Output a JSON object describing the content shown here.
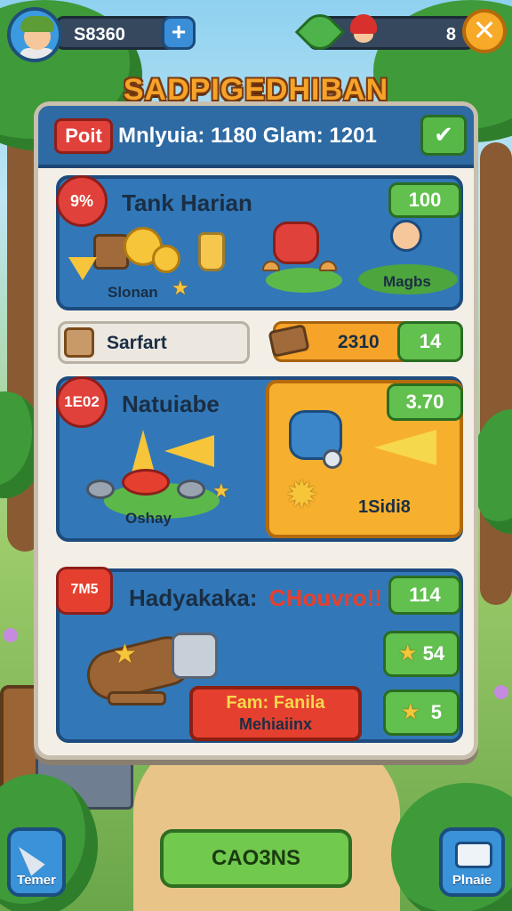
{
  "hud": {
    "coins": "S8360",
    "plus_label": "+",
    "gems": "8",
    "close_label": "✕"
  },
  "title": "SADPIGEDHIBAN",
  "header": {
    "port_label": "Poit",
    "text": "Mnlyuia: 1180 Glam: 1201",
    "confirm_label": "✔"
  },
  "section1": {
    "badge": "9%",
    "title": "Tank Harian",
    "value": "100",
    "item1_label": "Slonan",
    "item2_label": "Magbs"
  },
  "row2": {
    "search_text": "Sarfart",
    "amount": "2310",
    "count": "14"
  },
  "section2": {
    "badge": "1E02",
    "title": "Natuiabe",
    "item_label": "Oshay",
    "card_value": "3.70",
    "card_label": "1Sidi8"
  },
  "section3": {
    "badge": "7M5",
    "title": "Hadyakaka:",
    "title_highlight": "CHouvro!!",
    "value": "114",
    "action_line1": "Fam: Fanila",
    "action_line2": "Mehiaiinx",
    "reward1": "54",
    "reward2": "5"
  },
  "footer": {
    "left_label": "Temer",
    "center_label": "CAO3NS",
    "right_label": "Plnaie"
  },
  "colors": {
    "panel_blue": "#3278b8",
    "accent_green": "#62c04e",
    "accent_orange": "#f7b02e",
    "accent_red": "#e0413a",
    "title_gold": "#f6a32a"
  },
  "icons": [
    "avatar-icon",
    "plus-icon",
    "leaf-gem-icon",
    "hero-icon",
    "close-icon",
    "check-icon",
    "coin-icon",
    "crate-icon",
    "jar-icon",
    "gold-ingot-icon",
    "mushroom-icon",
    "mechanic-icon",
    "tag-icon",
    "gear-icon",
    "cannon-icon",
    "star-icon",
    "map-icon"
  ]
}
